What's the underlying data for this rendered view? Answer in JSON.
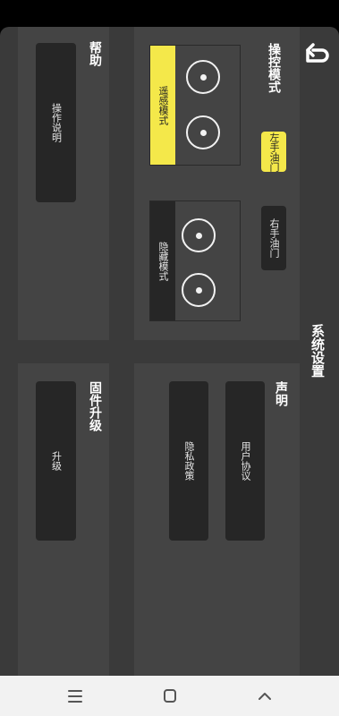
{
  "app": {
    "title": "系统设置",
    "back_icon": "back-arrow-icon"
  },
  "control_mode": {
    "title": "操控模式",
    "throttle_left": "左手油门",
    "throttle_right": "右手油门",
    "selected_throttle": "左手油门",
    "somatosensory_mode": "遥感模式",
    "hidden_mode": "隐藏模式",
    "selected_mode": "遥感模式"
  },
  "help": {
    "title": "帮助",
    "manual_button": "操作说明"
  },
  "statement": {
    "title": "声明",
    "user_agreement": "用户协议",
    "privacy_policy": "隐私政策"
  },
  "firmware": {
    "title": "固件升级",
    "upgrade_button": "升级"
  },
  "nav": {
    "menu_icon": "menu-icon",
    "home_icon": "home-square-icon",
    "back_icon": "chevron-up-icon"
  },
  "colors": {
    "accent": "#f4e84a",
    "tile": "#262626",
    "panel": "#444444",
    "background": "#3a3a3a"
  }
}
